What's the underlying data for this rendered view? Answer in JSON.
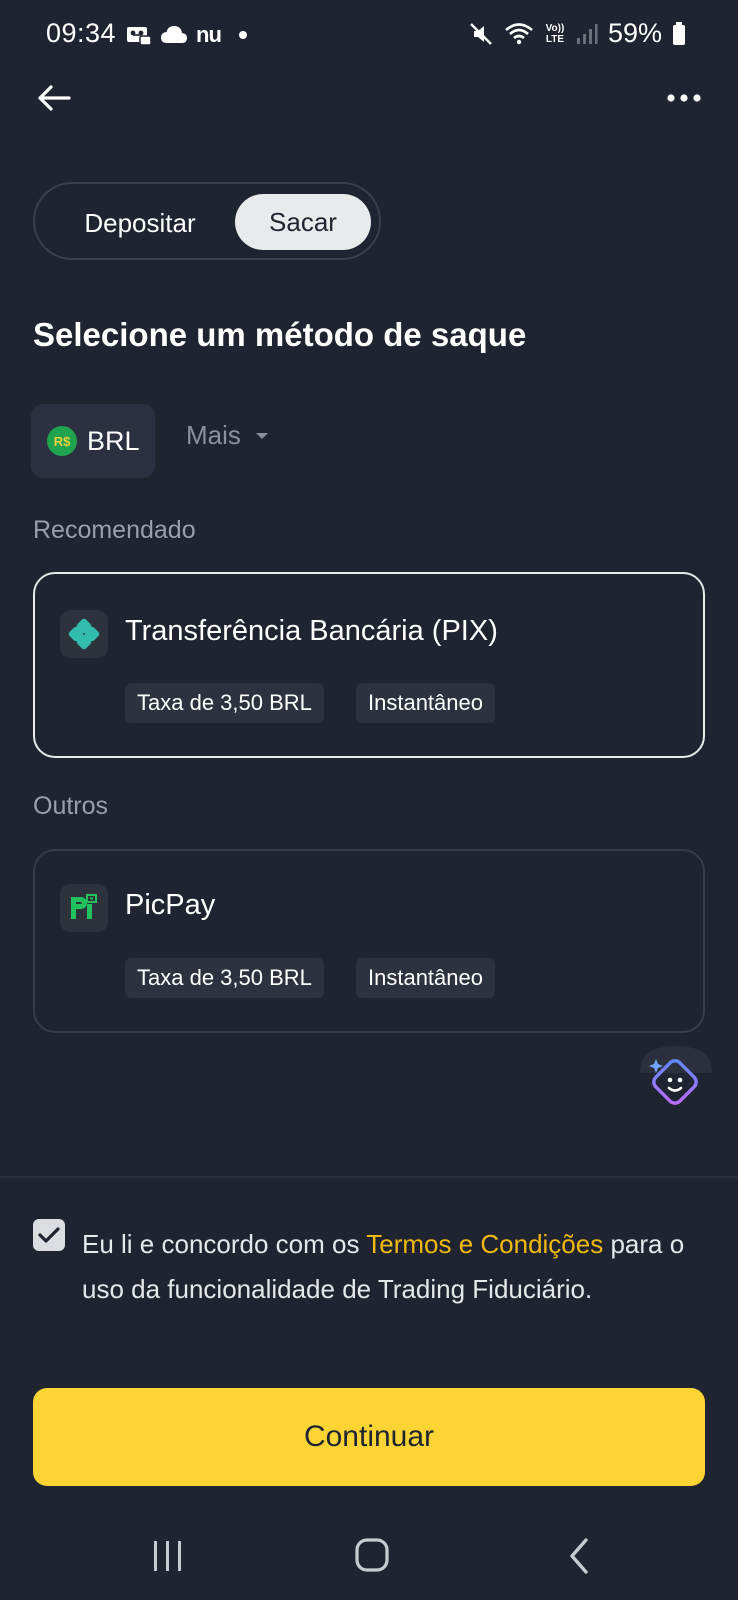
{
  "status_bar": {
    "time": "09:34",
    "left_icons": [
      "voicemail-icon",
      "cloud-icon",
      "nu-icon",
      "dot-icon"
    ],
    "nu_text": "nu",
    "battery": "59%",
    "right_icons": [
      "mute-icon",
      "wifi-icon",
      "volte-icon",
      "signal-icon",
      "battery-icon"
    ],
    "volte_text": "Vo)) LTE"
  },
  "tabs": {
    "deposit": "Depositar",
    "withdraw": "Sacar",
    "active": "withdraw"
  },
  "title": "Selecione um método de saque",
  "currency": {
    "badge": "R$",
    "selected": "BRL",
    "more": "Mais"
  },
  "sections": {
    "recommended_label": "Recomendado",
    "others_label": "Outros"
  },
  "methods": [
    {
      "name": "Transferência Bancária (PIX)",
      "fee": "Taxa de 3,50 BRL",
      "speed": "Instantâneo",
      "icon": "pix-icon",
      "selected": true
    },
    {
      "name": "PicPay",
      "fee": "Taxa de 3,50 BRL",
      "speed": "Instantâneo",
      "icon": "picpay-icon",
      "selected": false
    }
  ],
  "terms": {
    "checked": true,
    "prefix": "Eu li e concordo com os ",
    "link": "Termos e Condições",
    "suffix": " para o uso da funcionalidade de Trading Fiduciário."
  },
  "continue_label": "Continuar",
  "colors": {
    "background": "#1f2430",
    "accent": "#fcd535",
    "link": "#f0b90b",
    "pix": "#32bcad",
    "picpay": "#21c25e"
  }
}
